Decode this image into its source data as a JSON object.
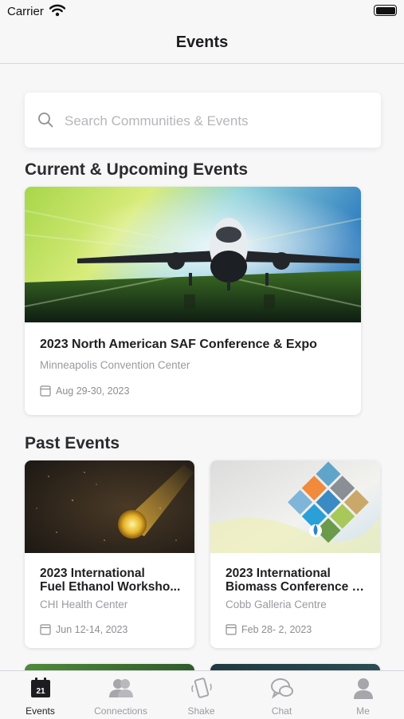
{
  "status": {
    "carrier": "Carrier"
  },
  "nav": {
    "title": "Events"
  },
  "search": {
    "placeholder": "Search Communities & Events"
  },
  "sections": {
    "current": "Current & Upcoming Events",
    "past": "Past Events"
  },
  "current_events": [
    {
      "title": "2023 North American SAF Conference & Expo",
      "venue": "Minneapolis Convention Center",
      "date": "Aug 29-30, 2023"
    }
  ],
  "past_events": [
    {
      "title_line1": "2023 International",
      "title_line2": "Fuel Ethanol Worksho...",
      "venue": "CHI Health Center",
      "date": "Jun 12-14, 2023"
    },
    {
      "title_line1": "2023 International",
      "title_line2": "Biomass Conference &...",
      "venue": "Cobb Galleria Centre",
      "date": "Feb 28- 2, 2023"
    }
  ],
  "tabs": [
    {
      "label": "Events",
      "icon": "calendar-icon",
      "badge": "21",
      "active": true
    },
    {
      "label": "Connections",
      "icon": "people-icon"
    },
    {
      "label": "Shake",
      "icon": "phone-shake-icon"
    },
    {
      "label": "Chat",
      "icon": "chat-bubbles-icon"
    },
    {
      "label": "Me",
      "icon": "person-icon"
    }
  ]
}
